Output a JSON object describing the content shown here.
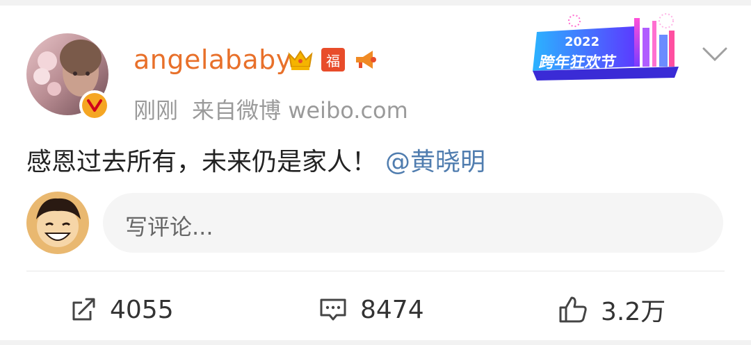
{
  "post": {
    "username": "angelababy",
    "time": "刚刚",
    "source": "来自微博 weibo.com",
    "text": "感恩过去所有，未来仍是家人！",
    "mention": "@黄晓明"
  },
  "banner": {
    "year": "2022",
    "title": "跨年狂欢节"
  },
  "badges": {
    "fu": "福"
  },
  "comment": {
    "placeholder": "写评论..."
  },
  "actions": {
    "repost_count": "4055",
    "comment_count": "8474",
    "like_count": "3.2万"
  },
  "colors": {
    "username": "#e8702a",
    "mention": "#507daf",
    "verified": "#f5a623"
  }
}
